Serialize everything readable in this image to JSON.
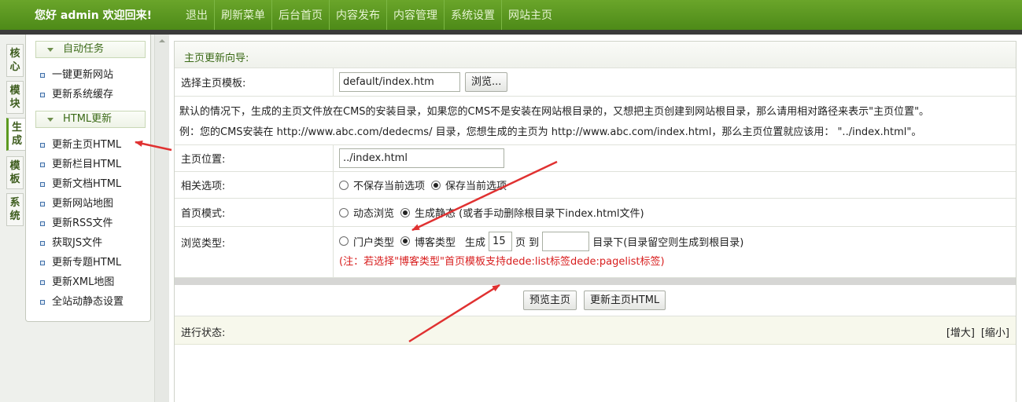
{
  "header": {
    "welcome": "您好 admin 欢迎回来!",
    "menu": [
      "退出",
      "刷新菜单",
      "后台首页",
      "内容发布",
      "内容管理",
      "系统设置",
      "网站主页"
    ]
  },
  "side_tabs": [
    "核心",
    "模块",
    "生成",
    "模板",
    "系统"
  ],
  "sidebar": {
    "groups": [
      {
        "title": "自动任务",
        "items": [
          "一键更新网站",
          "更新系统缓存"
        ]
      },
      {
        "title": "HTML更新",
        "items": [
          "更新主页HTML",
          "更新栏目HTML",
          "更新文档HTML",
          "更新网站地图",
          "更新RSS文件",
          "获取JS文件",
          "更新专题HTML",
          "更新XML地图",
          "全站动静态设置"
        ]
      }
    ]
  },
  "main": {
    "header": "主页更新向导:",
    "template": {
      "label": "选择主页模板:",
      "value": "default/index.htm",
      "browse": "浏览..."
    },
    "info_line1": "默认的情况下，生成的主页文件放在CMS的安装目录，如果您的CMS不是安装在网站根目录的，又想把主页创建到网站根目录，那么请用相对路径来表示\"主页位置\"。",
    "info_line2": "例：您的CMS安装在 http://www.abc.com/dedecms/ 目录，您想生成的主页为 http://www.abc.com/index.html，那么主页位置就应该用： \"../index.html\"。",
    "position": {
      "label": "主页位置:",
      "value": "../index.html"
    },
    "related": {
      "label": "相关选项:",
      "opt1": "不保存当前选项",
      "opt2": "保存当前选项",
      "selected": 2
    },
    "mode": {
      "label": "首页模式:",
      "opt1": "动态浏览",
      "opt2": "生成静态 (或者手动删除根目录下index.html文件)",
      "selected": 2
    },
    "browse_type": {
      "label": "浏览类型:",
      "opt1": "门户类型",
      "opt2": "博客类型",
      "selected": 2,
      "gen": "生成",
      "pages": "15",
      "page_to": "页 到",
      "dir_value": "",
      "dir_hint": "目录下(目录留空则生成到根目录)",
      "note": "(注：若选择\"博客类型\"首页模板支持dede:list标签dede:pagelist标签)"
    },
    "buttons": {
      "preview": "预览主页",
      "update": "更新主页HTML"
    },
    "status": {
      "label": "进行状态:",
      "enlarge": "[增大]",
      "shrink": "[缩小]"
    }
  },
  "colors": {
    "brand_green": "#5c9a20",
    "annotation_red": "#e03131",
    "note_red": "#d81e1e"
  }
}
